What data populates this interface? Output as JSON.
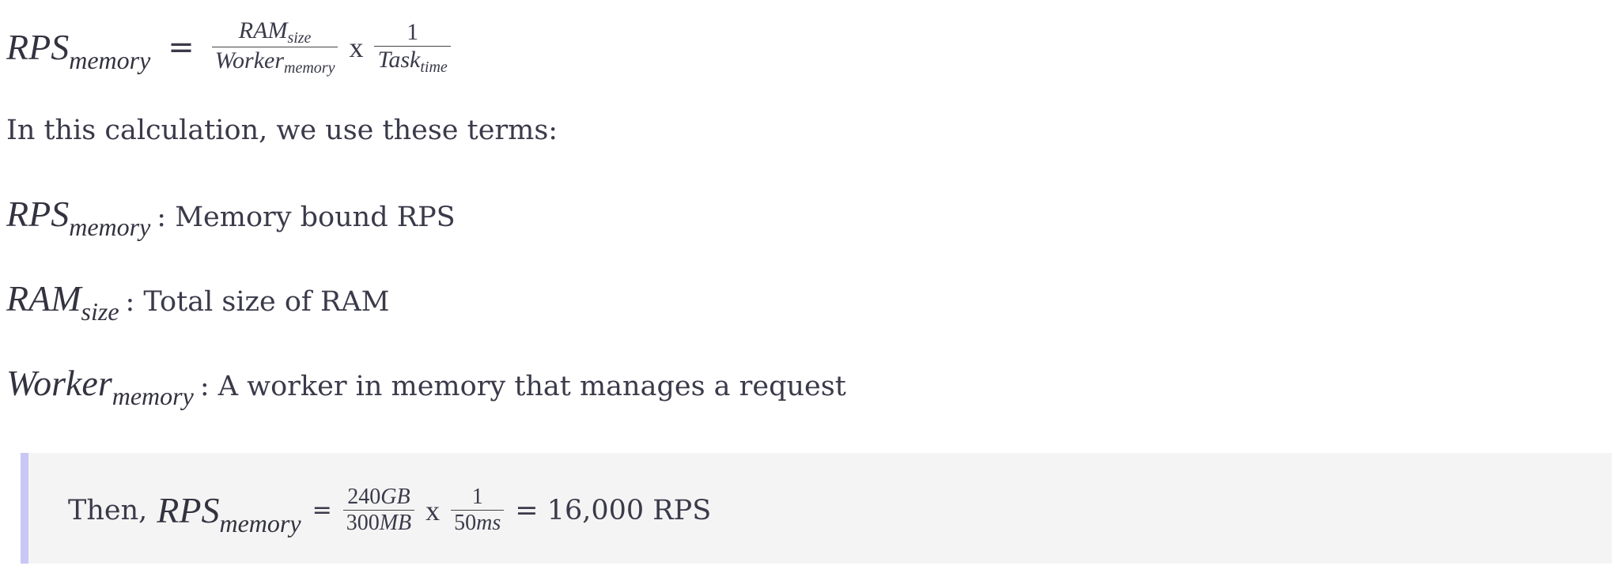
{
  "formula": {
    "lhs_main": "RPS",
    "lhs_sub": "memory",
    "equals": "=",
    "frac1_num_main": "RAM",
    "frac1_num_sub": "size",
    "frac1_den_main": "Worker",
    "frac1_den_sub": "memory",
    "times": "x",
    "frac2_num": "1",
    "frac2_den_main": "Task",
    "frac2_den_sub": "time"
  },
  "intro": "In this calculation, we use these terms:",
  "terms": [
    {
      "main": "RPS",
      "sub": "memory",
      "desc": ": Memory bound RPS"
    },
    {
      "main": "RAM",
      "sub": "size",
      "desc": ": Total size of RAM"
    },
    {
      "main": "Worker",
      "sub": "memory",
      "desc": ": A worker in memory that manages a request"
    }
  ],
  "callout": {
    "prefix": "Then,",
    "lhs_main": "RPS",
    "lhs_sub": "memory",
    "equals": "=",
    "frac1_num_value": "240",
    "frac1_num_unit": "GB",
    "frac1_den_value": "300",
    "frac1_den_unit": "MB",
    "times": "x",
    "frac2_num": "1",
    "frac2_den_value": "50",
    "frac2_den_unit": "ms",
    "result": "= 16,000 RPS"
  }
}
